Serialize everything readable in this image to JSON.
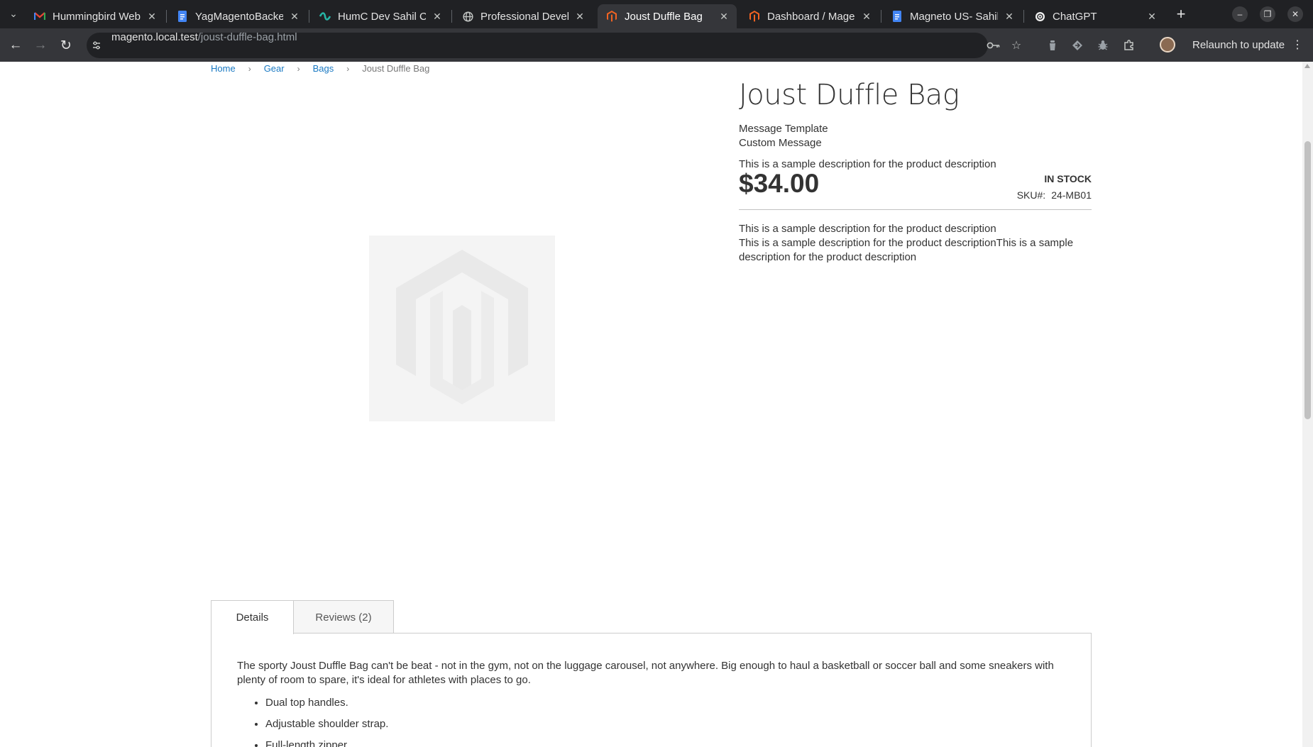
{
  "browser": {
    "tabs": [
      {
        "title": "Hummingbird Web",
        "favicon": "gmail-icon",
        "active": false
      },
      {
        "title": "YagMagentoBacker",
        "favicon": "docs-icon",
        "active": false
      },
      {
        "title": "HumC Dev Sahil Ch",
        "favicon": "app-icon",
        "active": false
      },
      {
        "title": "Professional Devel",
        "favicon": "globe-icon",
        "active": false
      },
      {
        "title": "Joust Duffle Bag",
        "favicon": "magento-icon",
        "active": true
      },
      {
        "title": "Dashboard / Mager",
        "favicon": "magento-icon",
        "active": false
      },
      {
        "title": "Magneto US- Sahil",
        "favicon": "docs-icon",
        "active": false
      },
      {
        "title": "ChatGPT",
        "favicon": "chatgpt-icon",
        "active": false
      }
    ],
    "url_host": "magento.local.test",
    "url_path": "/joust-duffle-bag.html",
    "relaunch_label": "Relaunch to update"
  },
  "breadcrumbs": [
    "Home",
    "Gear",
    "Bags",
    "Joust Duffle Bag"
  ],
  "product": {
    "title": "Joust Duffle Bag",
    "message_template": "Message Template",
    "custom_message": "Custom Message",
    "short_description": "This is a sample description for the product description",
    "price": "$34.00",
    "stock": "IN STOCK",
    "sku_label": "SKU#:",
    "sku": "24-MB01",
    "overview_line1": "This is a sample description for the product description",
    "overview_line2": "This is a sample description for the product descriptionThis is a sample description for the product description"
  },
  "tabs": {
    "details_label": "Details",
    "reviews_label": "Reviews (2)",
    "details_text": "The sporty Joust Duffle Bag can't be beat - not in the gym, not on the luggage carousel, not anywhere. Big enough to haul a basketball or soccer ball and some sneakers with plenty of room to spare, it's ideal for athletes with places to go.",
    "features": [
      "Dual top handles.",
      "Adjustable shoulder strap.",
      "Full-length zipper."
    ]
  },
  "colors": {
    "link": "#1979c3",
    "text": "#333333",
    "chrome_dark": "#202124",
    "chrome_toolbar": "#35363a"
  }
}
